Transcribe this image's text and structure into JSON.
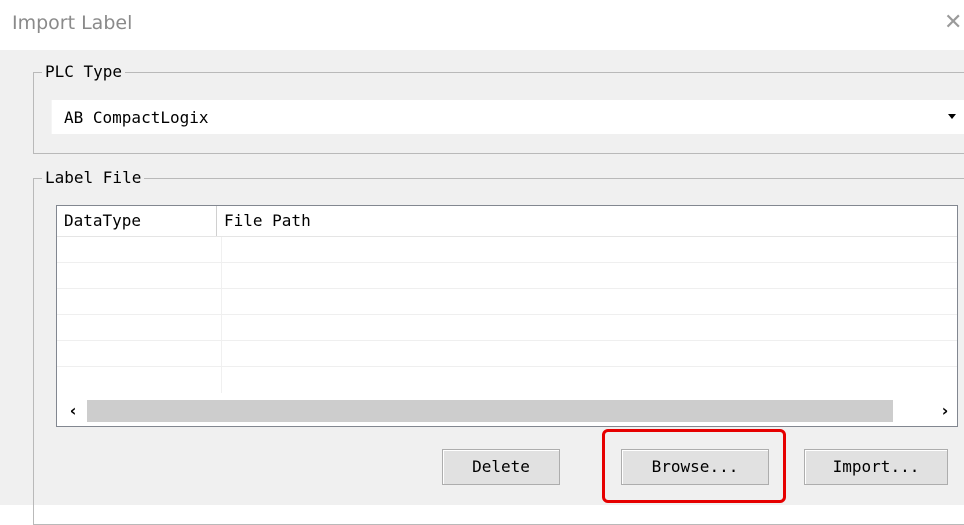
{
  "window": {
    "title": "Import Label"
  },
  "plc_type": {
    "caption": "PLC Type",
    "selected": "AB CompactLogix"
  },
  "label_file": {
    "caption": "Label File",
    "columns": [
      "DataType",
      "File Path"
    ],
    "rows": [
      [
        "",
        ""
      ],
      [
        "",
        ""
      ],
      [
        "",
        ""
      ],
      [
        "",
        ""
      ],
      [
        "",
        ""
      ],
      [
        "",
        ""
      ]
    ]
  },
  "buttons": {
    "delete": "Delete",
    "browse": "Browse...",
    "import": "Import..."
  },
  "colors": {
    "highlight": "#e60000",
    "dialog_bg": "#f0f0f0"
  }
}
